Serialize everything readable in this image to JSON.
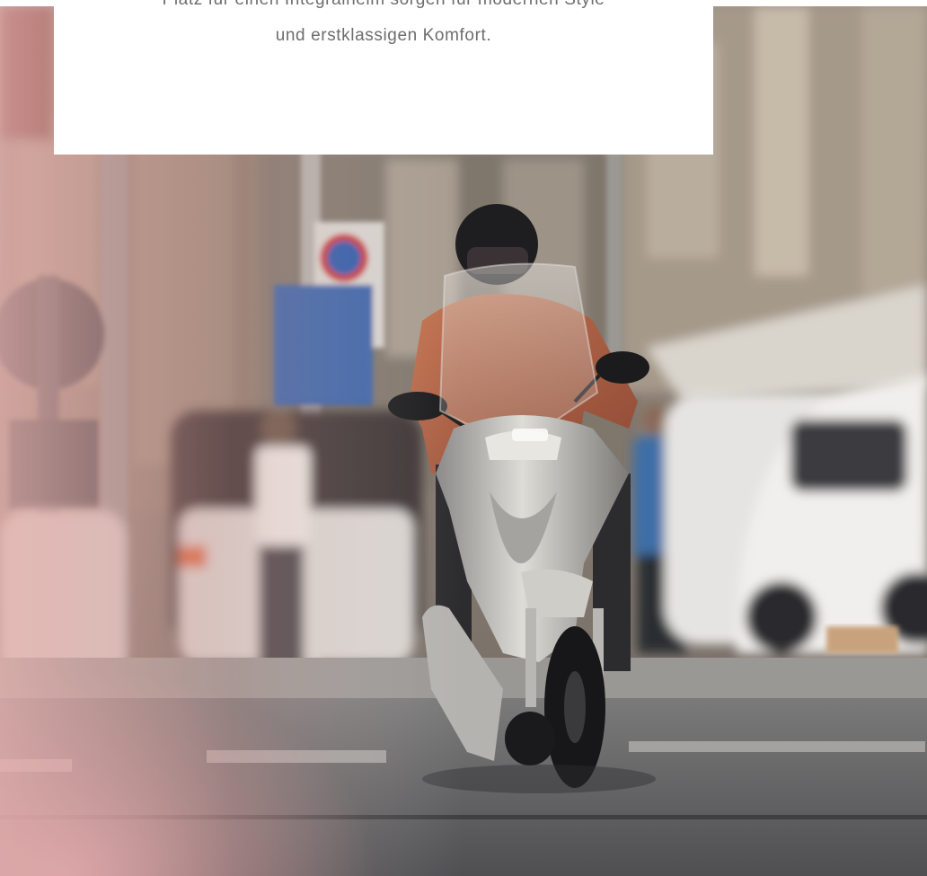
{
  "text_card": {
    "line_1": "Platz für einen Integralhelm sorgen für modernen Style",
    "line_2": "und erstklassigen Komfort."
  },
  "hero_image": {
    "icon": "scooter-rider-photo",
    "colors": {
      "jacket": "#b5654a",
      "scooter_body": "#c9c6c1",
      "helmet": "#1c1c1e",
      "road": "#5e5e60",
      "building": "#a89c8e"
    }
  }
}
